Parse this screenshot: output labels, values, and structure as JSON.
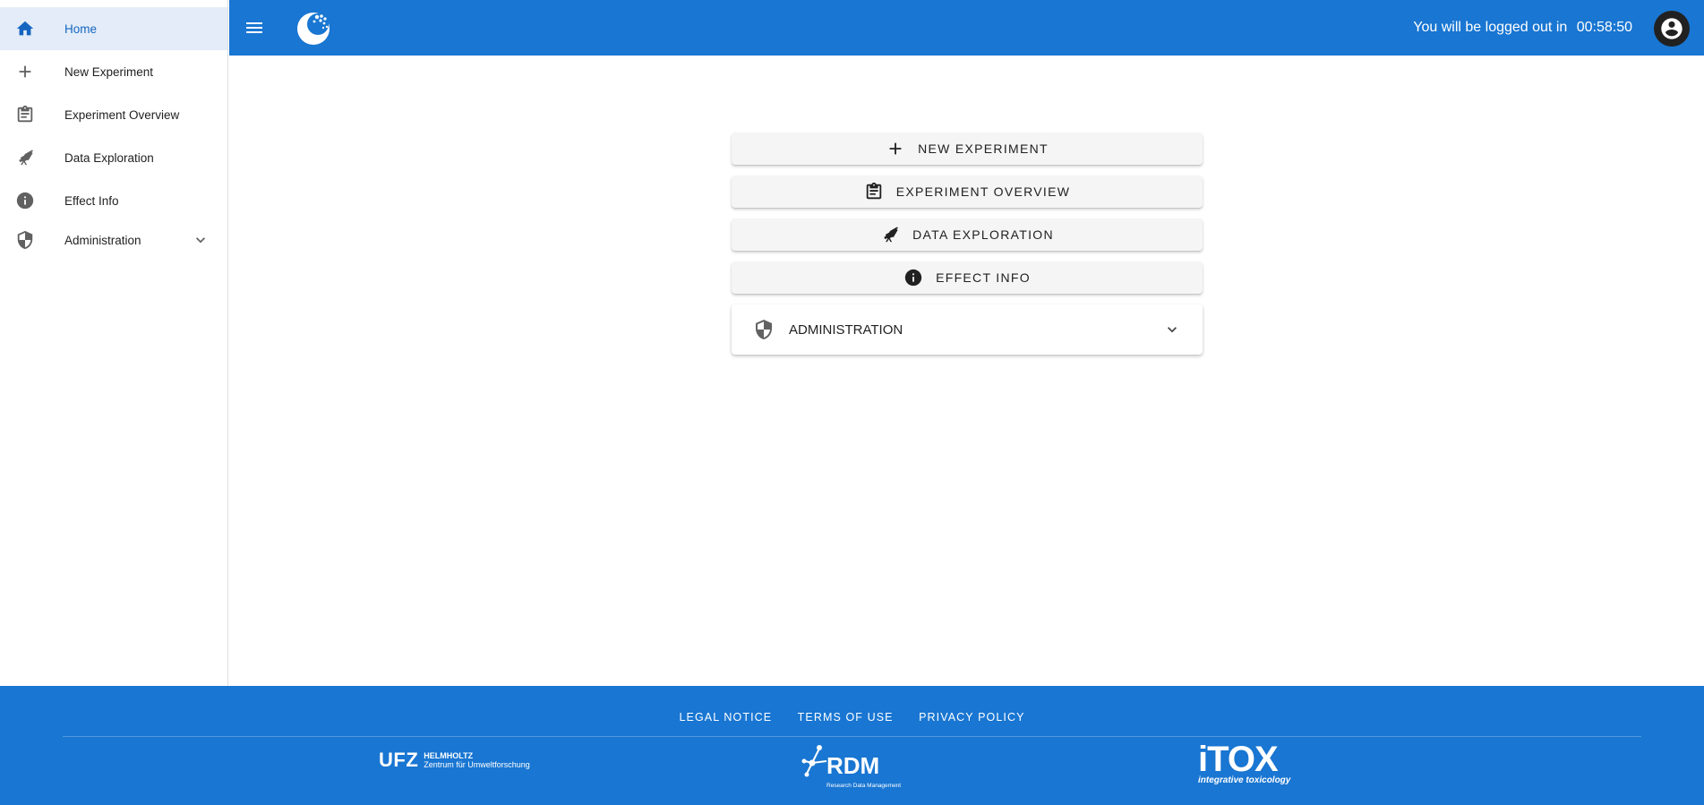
{
  "sidebar": {
    "items": [
      {
        "label": "Home",
        "icon": "home-icon",
        "active": true
      },
      {
        "label": "New Experiment",
        "icon": "plus-icon"
      },
      {
        "label": "Experiment Overview",
        "icon": "clipboard-icon"
      },
      {
        "label": "Data Exploration",
        "icon": "telescope-icon"
      },
      {
        "label": "Effect Info",
        "icon": "info-icon"
      },
      {
        "label": "Administration",
        "icon": "shield-icon",
        "expandable": true
      }
    ]
  },
  "topbar": {
    "logout_text": "You will be logged out in",
    "logout_time": "00:58:50",
    "color": "#1976d2"
  },
  "main": {
    "buttons": [
      {
        "label": "NEW EXPERIMENT",
        "icon": "plus-icon"
      },
      {
        "label": "EXPERIMENT OVERVIEW",
        "icon": "clipboard-icon"
      },
      {
        "label": "DATA EXPLORATION",
        "icon": "telescope-icon"
      },
      {
        "label": "EFFECT INFO",
        "icon": "info-icon"
      }
    ],
    "admin_panel": {
      "label": "ADMINISTRATION",
      "icon": "shield-icon"
    }
  },
  "footer": {
    "links": [
      "LEGAL NOTICE",
      "TERMS OF USE",
      "PRIVACY POLICY"
    ],
    "logos": {
      "ufz": {
        "mark": "UFZ",
        "line1": "HELMHOLTZ",
        "line2": "Zentrum für Umweltforschung"
      },
      "rdm": {
        "mark": "RDM",
        "sub": "Research Data Management"
      },
      "itox": {
        "mark": "iTOX",
        "sub": "integrative toxicology"
      }
    }
  }
}
